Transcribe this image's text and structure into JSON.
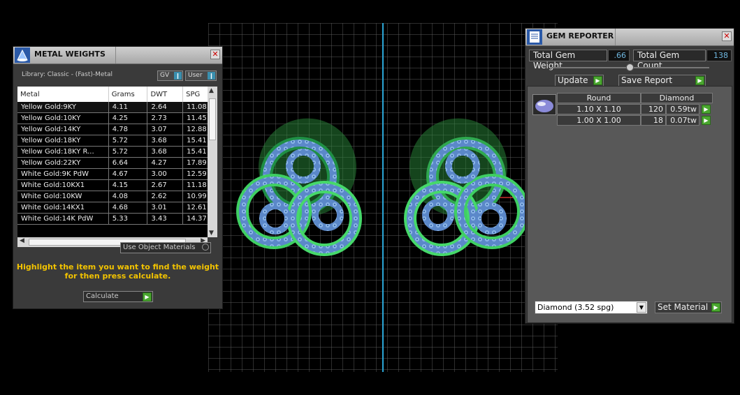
{
  "metal_weights": {
    "title": "METAL WEIGHTS",
    "library": "Library: Classic - (Fast)-Metal",
    "gv_label": "GV",
    "user_label": "User",
    "columns": [
      "Metal",
      "Grams",
      "DWT",
      "SPG"
    ],
    "rows": [
      [
        "Yellow Gold:9KY",
        "4.11",
        "2.64",
        "11.08"
      ],
      [
        "Yellow Gold:10KY",
        "4.25",
        "2.73",
        "11.45"
      ],
      [
        "Yellow Gold:14KY",
        "4.78",
        "3.07",
        "12.88"
      ],
      [
        "Yellow Gold:18KY",
        "5.72",
        "3.68",
        "15.41"
      ],
      [
        "Yellow Gold:18KY R...",
        "5.72",
        "3.68",
        "15.41"
      ],
      [
        "Yellow Gold:22KY",
        "6.64",
        "4.27",
        "17.89"
      ],
      [
        "White Gold:9K PdW",
        "4.67",
        "3.00",
        "12.59"
      ],
      [
        "White Gold:10KX1",
        "4.15",
        "2.67",
        "11.18"
      ],
      [
        "White Gold:10KW",
        "4.08",
        "2.62",
        "10.99"
      ],
      [
        "White Gold:14KX1",
        "4.68",
        "3.01",
        "12.61"
      ],
      [
        "White Gold:14K PdW",
        "5.33",
        "3.43",
        "14.37"
      ]
    ],
    "use_object_materials": "Use Object Materials",
    "hint_line1": "Highlight the item you want to find the weight",
    "hint_line2": "for then press calculate.",
    "calculate_label": "Calculate"
  },
  "gem_reporter": {
    "title": "GEM REPORTER",
    "total_weight_label": "Total Gem Weight",
    "total_weight_value": ".66",
    "total_count_label": "Total Gem Count",
    "total_count_value": "138",
    "update_label": "Update",
    "save_report_label": "Save Report",
    "col_shape": "Round",
    "col_material": "Diamond",
    "gems": [
      {
        "size": "1.10 X 1.10",
        "count": "120",
        "tw": "0.59tw"
      },
      {
        "size": "1.00 X 1.00",
        "count": "18",
        "tw": "0.07tw"
      }
    ],
    "material_select": "Diamond    (3.52 spg)",
    "set_material_label": "Set Material"
  },
  "colors": {
    "accent_yellow": "#f2c300",
    "grid_line": "#6a6a6a",
    "axis_blue": "#2aa6d6",
    "metal_green": "#5fd06a",
    "gem_blue": "#7aa8e0",
    "button_green": "#4aa72f"
  }
}
